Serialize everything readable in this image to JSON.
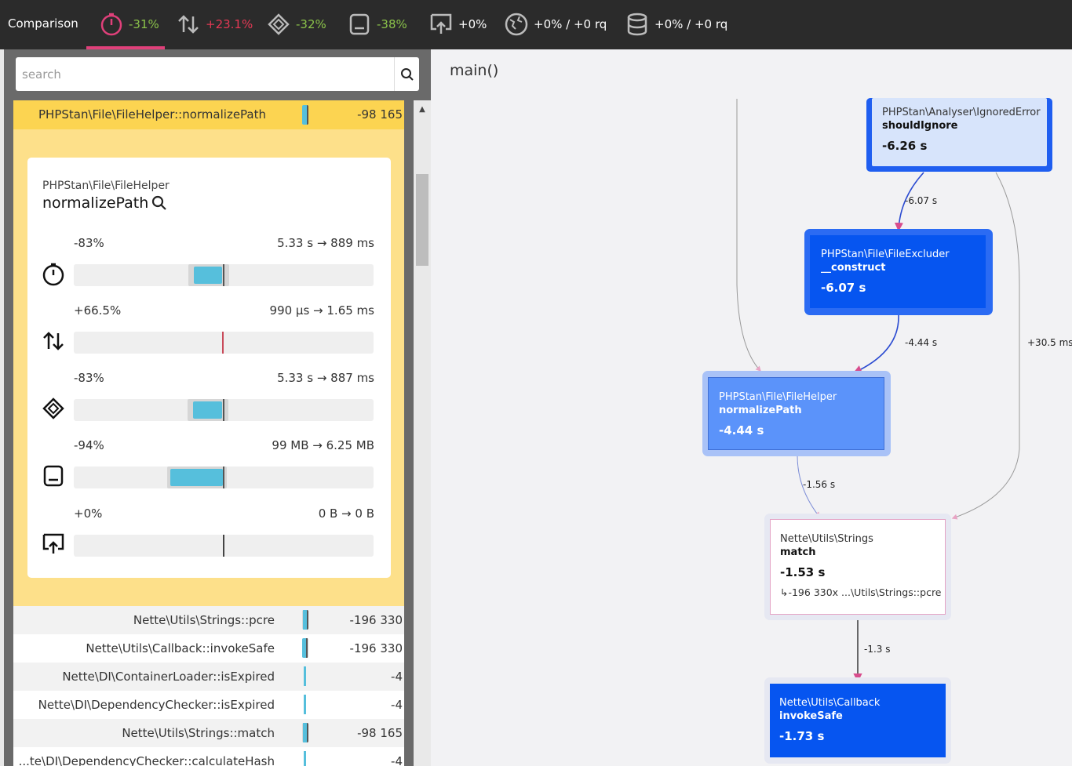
{
  "topbar": {
    "title": "Comparison",
    "metrics": [
      {
        "icon": "stopwatch-icon",
        "value": "-31%",
        "color": "#8bc34a"
      },
      {
        "icon": "arrows-up-down-icon",
        "value": "+23.1%",
        "color": "#e53955"
      },
      {
        "icon": "cpu-icon",
        "value": "-32%",
        "color": "#8bc34a"
      },
      {
        "icon": "memory-icon",
        "value": "-38%",
        "color": "#8bc34a"
      },
      {
        "icon": "network-upload-icon",
        "value": "+0%",
        "color": "#ffffff"
      },
      {
        "icon": "globe-icon",
        "value": "+0% / +0 rq",
        "color": "#ffffff"
      },
      {
        "icon": "database-icon",
        "value": "+0% / +0 rq",
        "color": "#ffffff"
      }
    ]
  },
  "search": {
    "placeholder": "search"
  },
  "selected": {
    "name": "PHPStan\\File\\FileHelper::normalizePath",
    "value": "-98 165"
  },
  "detail": {
    "class": "PHPStan\\File\\FileHelper",
    "function": "normalizePath",
    "metrics": [
      {
        "icon": "stopwatch-icon",
        "pct": "-83%",
        "range": "5.33 s → 889 ms"
      },
      {
        "icon": "arrows-up-down-icon",
        "pct": "+66.5%",
        "range": "990 µs → 1.65 ms"
      },
      {
        "icon": "cpu-icon",
        "pct": "-83%",
        "range": "5.33 s → 887 ms"
      },
      {
        "icon": "memory-icon",
        "pct": "-94%",
        "range": "99 MB → 6.25 MB"
      },
      {
        "icon": "network-upload-icon",
        "pct": "+0%",
        "range": "0 B → 0 B"
      }
    ]
  },
  "list": [
    {
      "name": "Nette\\Utils\\Strings::pcre",
      "value": "-196 330"
    },
    {
      "name": "Nette\\Utils\\Callback::invokeSafe",
      "value": "-196 330"
    },
    {
      "name": "Nette\\DI\\ContainerLoader::isExpired",
      "value": "-4"
    },
    {
      "name": "Nette\\DI\\DependencyChecker::isExpired",
      "value": "-4"
    },
    {
      "name": "Nette\\Utils\\Strings::match",
      "value": "-98 165"
    },
    {
      "name": "...te\\DI\\DependencyChecker::calculateHash",
      "value": "-4"
    }
  ],
  "graph": {
    "title": "main()",
    "nodes": [
      {
        "id": "ignored",
        "class": "PHPStan\\Analyser\\IgnoredError",
        "function": "shouldIgnore",
        "time": "-6.26 s"
      },
      {
        "id": "excluder",
        "class": "PHPStan\\File\\FileExcluder",
        "function": "__construct",
        "time": "-6.07 s"
      },
      {
        "id": "normalize",
        "class": "PHPStan\\File\\FileHelper",
        "function": "normalizePath",
        "time": "-4.44 s"
      },
      {
        "id": "match",
        "class": "Nette\\Utils\\Strings",
        "function": "match",
        "time": "-1.53 s",
        "sub": "↳-196 330x ...\\Utils\\Strings::pcre"
      },
      {
        "id": "invoke",
        "class": "Nette\\Utils\\Callback",
        "function": "invokeSafe",
        "time": "-1.73 s"
      }
    ],
    "edges": [
      "-6.07 s",
      "-4.44 s",
      "+30.5 ms",
      "-1.56 s",
      "-1.3 s"
    ]
  }
}
